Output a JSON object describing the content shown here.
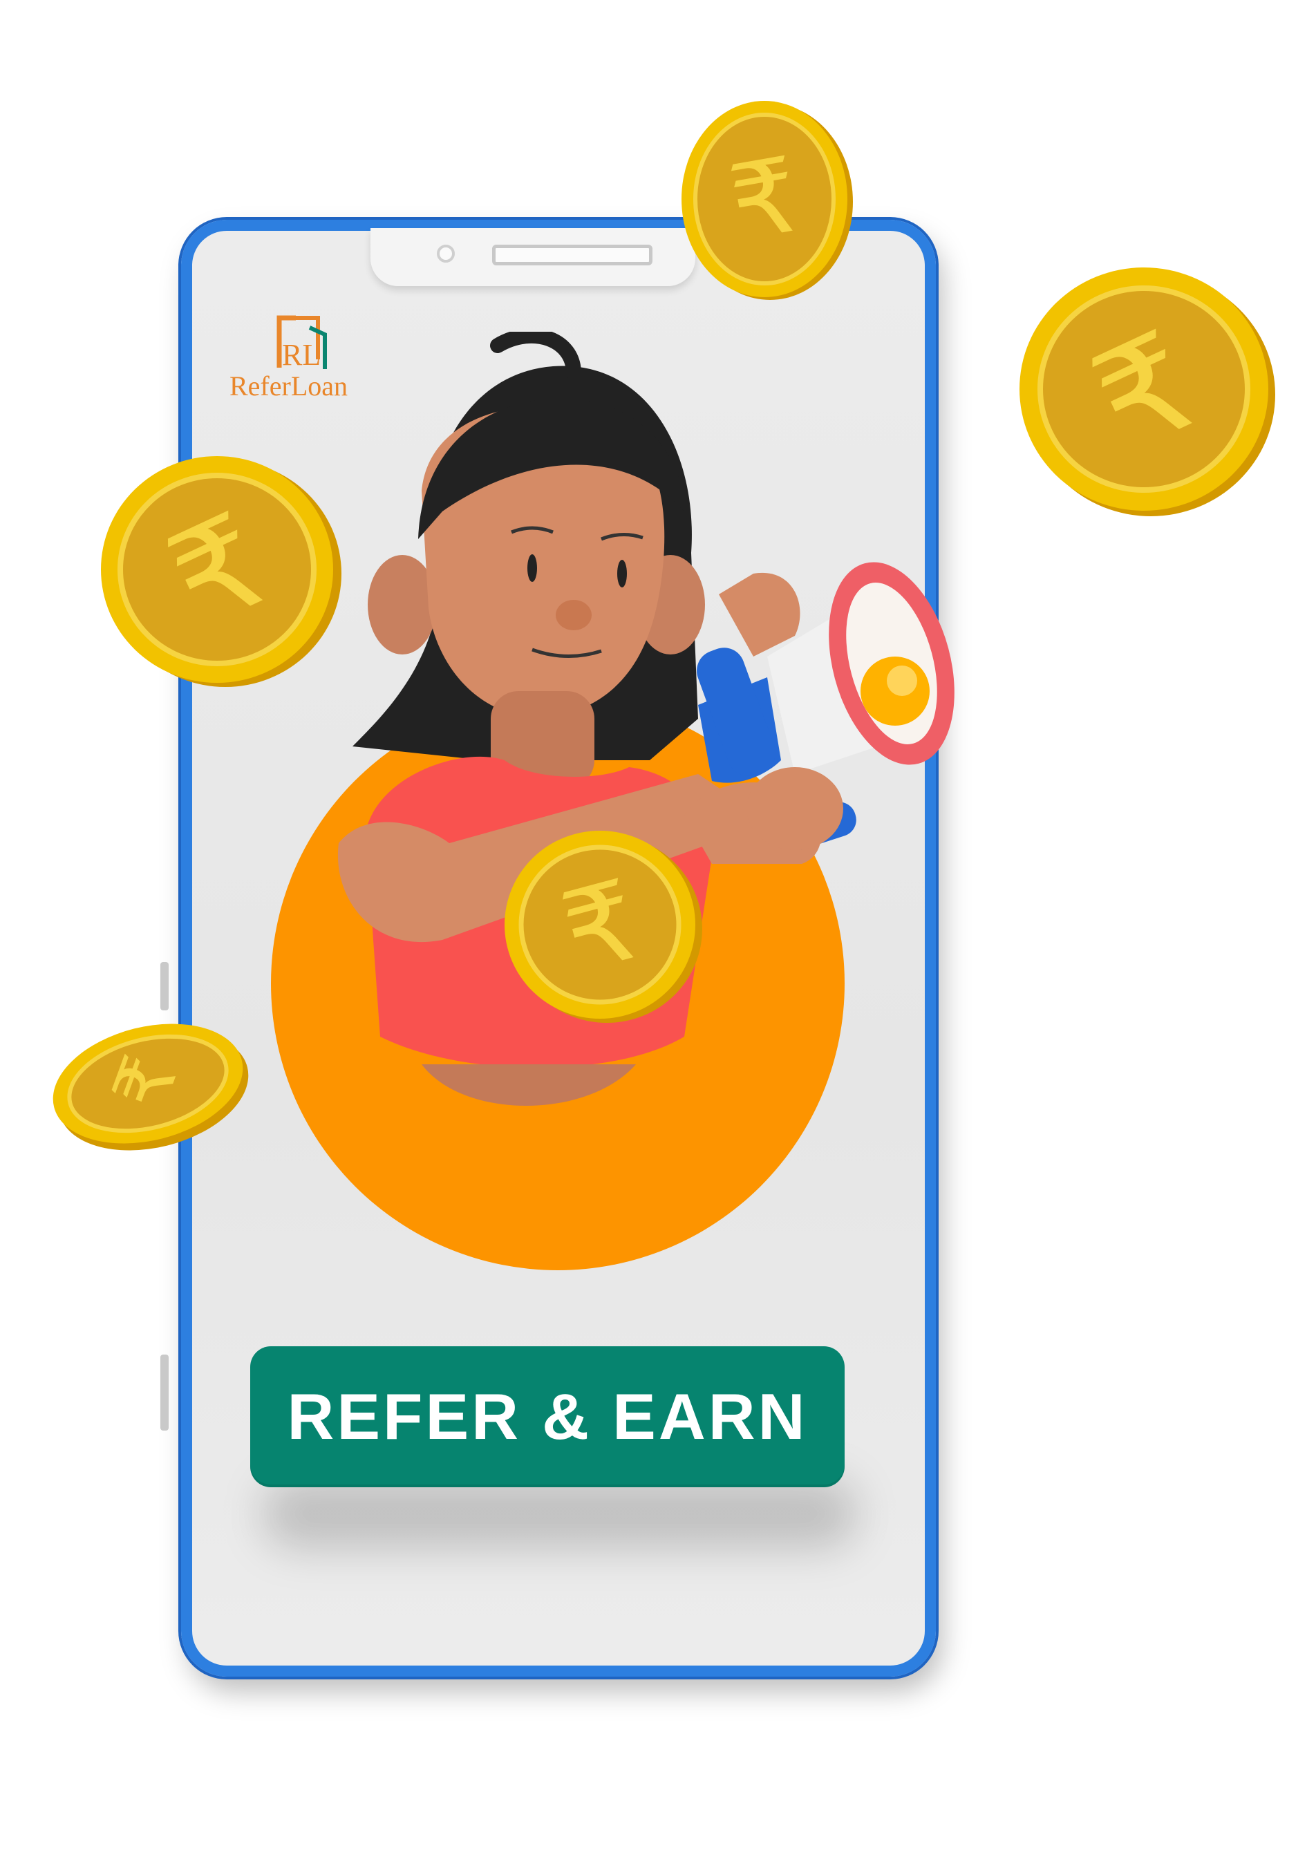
{
  "brand": {
    "logo_monogram": "RL",
    "logo_text": "ReferLoan"
  },
  "cta": {
    "label": "REFER & EARN"
  },
  "coins": {
    "symbol": "₹",
    "color": "#f2c200"
  },
  "colors": {
    "phone_frame": "#2d7fe0",
    "accent_circle": "#fd9400",
    "cta_background": "#06846f",
    "logo_orange": "#e9862a",
    "logo_green": "#0a8570"
  },
  "icons": [
    "rupee-coin-icon",
    "megaphone-icon"
  ]
}
